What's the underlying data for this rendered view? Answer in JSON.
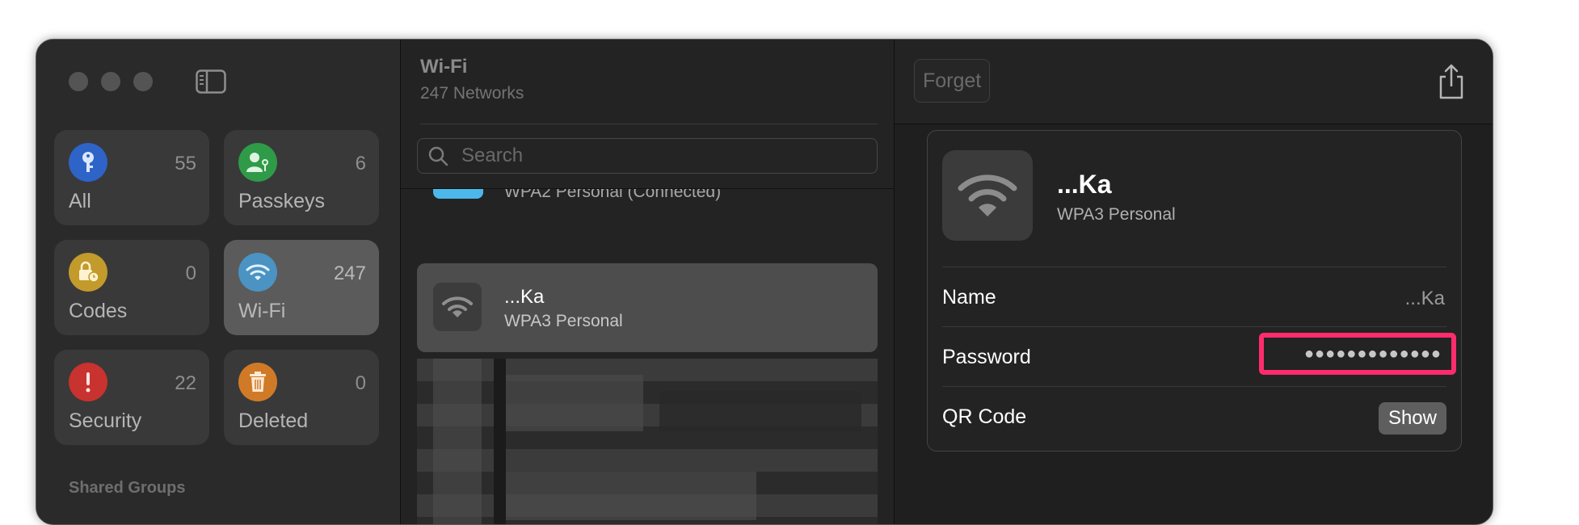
{
  "sidebar": {
    "tiles": [
      {
        "label": "All",
        "count": "55",
        "color": "#2e63c7",
        "icon": "key-icon"
      },
      {
        "label": "Passkeys",
        "count": "6",
        "color": "#2f9a47",
        "icon": "person-key-icon"
      },
      {
        "label": "Codes",
        "count": "0",
        "color": "#c39b2c",
        "icon": "lock-clock-icon"
      },
      {
        "label": "Wi-Fi",
        "count": "247",
        "color": "#4a93c2",
        "icon": "wifi-icon"
      },
      {
        "label": "Security",
        "count": "22",
        "color": "#c8322f",
        "icon": "exclamation-icon"
      },
      {
        "label": "Deleted",
        "count": "0",
        "color": "#d07a28",
        "icon": "trash-icon"
      }
    ],
    "selected": "Wi-Fi",
    "shared_heading": "Shared Groups"
  },
  "list": {
    "title": "Wi-Fi",
    "subtitle": "247 Networks",
    "search_placeholder": "Search",
    "partial_row_subtitle": "WPA2 Personal (Connected)",
    "selected_row": {
      "name": "...Ka",
      "type": "WPA3 Personal"
    }
  },
  "detail": {
    "forget_label": "Forget",
    "title": "...Ka",
    "subtitle": "WPA3 Personal",
    "rows": {
      "name_label": "Name",
      "name_value": "...Ka",
      "password_label": "Password",
      "password_value": "●●●●●●●●●●●●●",
      "qr_label": "QR Code",
      "qr_button": "Show"
    },
    "highlight_color": "#ff2c6d"
  }
}
